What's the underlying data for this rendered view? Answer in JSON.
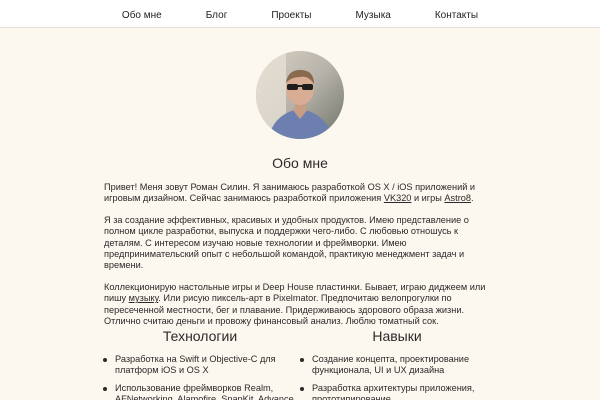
{
  "nav": {
    "items": [
      "Обо мне",
      "Блог",
      "Проекты",
      "Музыка",
      "Контакты"
    ]
  },
  "about": {
    "title": "Обо мне",
    "p1_a": "Привет! Меня зовут Роман Силин. Я занимаюсь разработкой OS X / iOS приложений и игровым дизайном. Сейчас занимаюсь разработкой приложения ",
    "p1_link1": "VK320",
    "p1_b": " и игры ",
    "p1_link2": "Astro8",
    "p1_c": ".",
    "p2": "Я за создание эффективных, красивых и удобных продуктов. Имею представление о полном цикле разработки, выпуска и поддержки чего-либо. С любовью отношусь к деталям. С интересом изучаю новые технологии и фреймворки. Имею предпринимательский опыт с небольшой командой, практикую менеджмент задач и времени.",
    "p3_a": "Коллекционирую настольные игры и Deep House пластинки. Бывает, играю диджеем или пишу ",
    "p3_link": "музыку",
    "p3_b": ". Или рисую пиксель-арт в Pixelmator. Предпочитаю велопрогулки по пересеченной местности, бег и плавание. Придерживаюсь здорового образа жизни. Отлично считаю деньги и провожу финансовый анализ. Люблю томатный сок."
  },
  "technologies": {
    "title": "Технологии",
    "items": [
      "Разработка на Swift и Objective-C для платформ iOS и OS X",
      "Использование фреймворков Realm, AFNetworking, Alamofire, SnapKit, Advance"
    ]
  },
  "skills": {
    "title": "Навыки",
    "items": [
      "Создание концепта, проектирование функционала, UI и UX дизайна",
      "Разработка архитектуры приложения, прототипирование"
    ]
  },
  "colors": {
    "background": "#fdf8ef",
    "nav_background": "#ffffff",
    "text": "#2a2a2a"
  }
}
